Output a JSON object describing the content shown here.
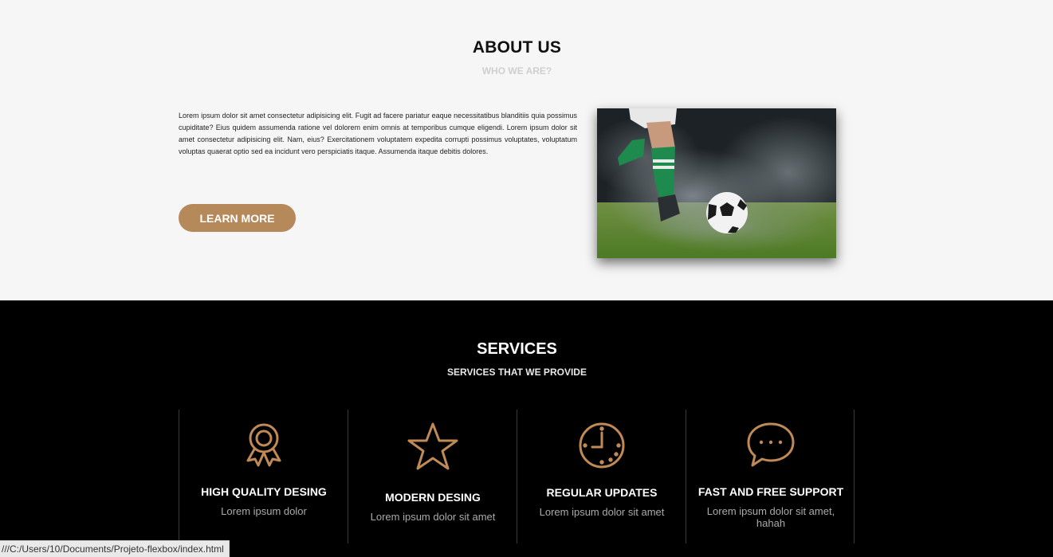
{
  "about": {
    "title": "ABOUT US",
    "subtitle": "WHO WE ARE?",
    "paragraph": "Lorem ipsum dolor sit amet consectetur adipisicing elit. Fugit ad facere pariatur eaque necessitatibus blanditiis quia possimus cupiditate? Eius quidem assumenda ratione vel dolorem enim omnis at temporibus cumque eligendi. Lorem ipsum dolor sit amet consectetur adipisicing elit. Nam, eius? Exercitationem voluptatem expedita corrupti possimus voluptates, voluptatum voluptas quaerat optio sed ea incidunt vero perspiciatis itaque. Assumenda itaque debitis dolores.",
    "button_label": "LEARN MORE"
  },
  "services": {
    "title": "SERVICES",
    "subtitle": "SERVICES THAT WE PROVIDE",
    "items": [
      {
        "title": "HIGH QUALITY DESING",
        "text": "Lorem ipsum dolor",
        "icon": "award-icon"
      },
      {
        "title": "MODERN DESING",
        "text": "Lorem ipsum dolor sit amet",
        "icon": "star-icon"
      },
      {
        "title": "REGULAR UPDATES",
        "text": "Lorem ipsum dolor sit amet",
        "icon": "clock-icon"
      },
      {
        "title": "FAST AND FREE SUPPORT",
        "text": "Lorem ipsum dolor sit amet, hahah",
        "icon": "chat-bubble-icon"
      }
    ]
  },
  "statusbar": {
    "url": "///C:/Users/10/Documents/Projeto-flexbox/index.html"
  },
  "colors": {
    "accent": "#b5895a",
    "icon": "#c08a56",
    "about_bg": "#f6f6f6",
    "services_bg": "#000000"
  }
}
